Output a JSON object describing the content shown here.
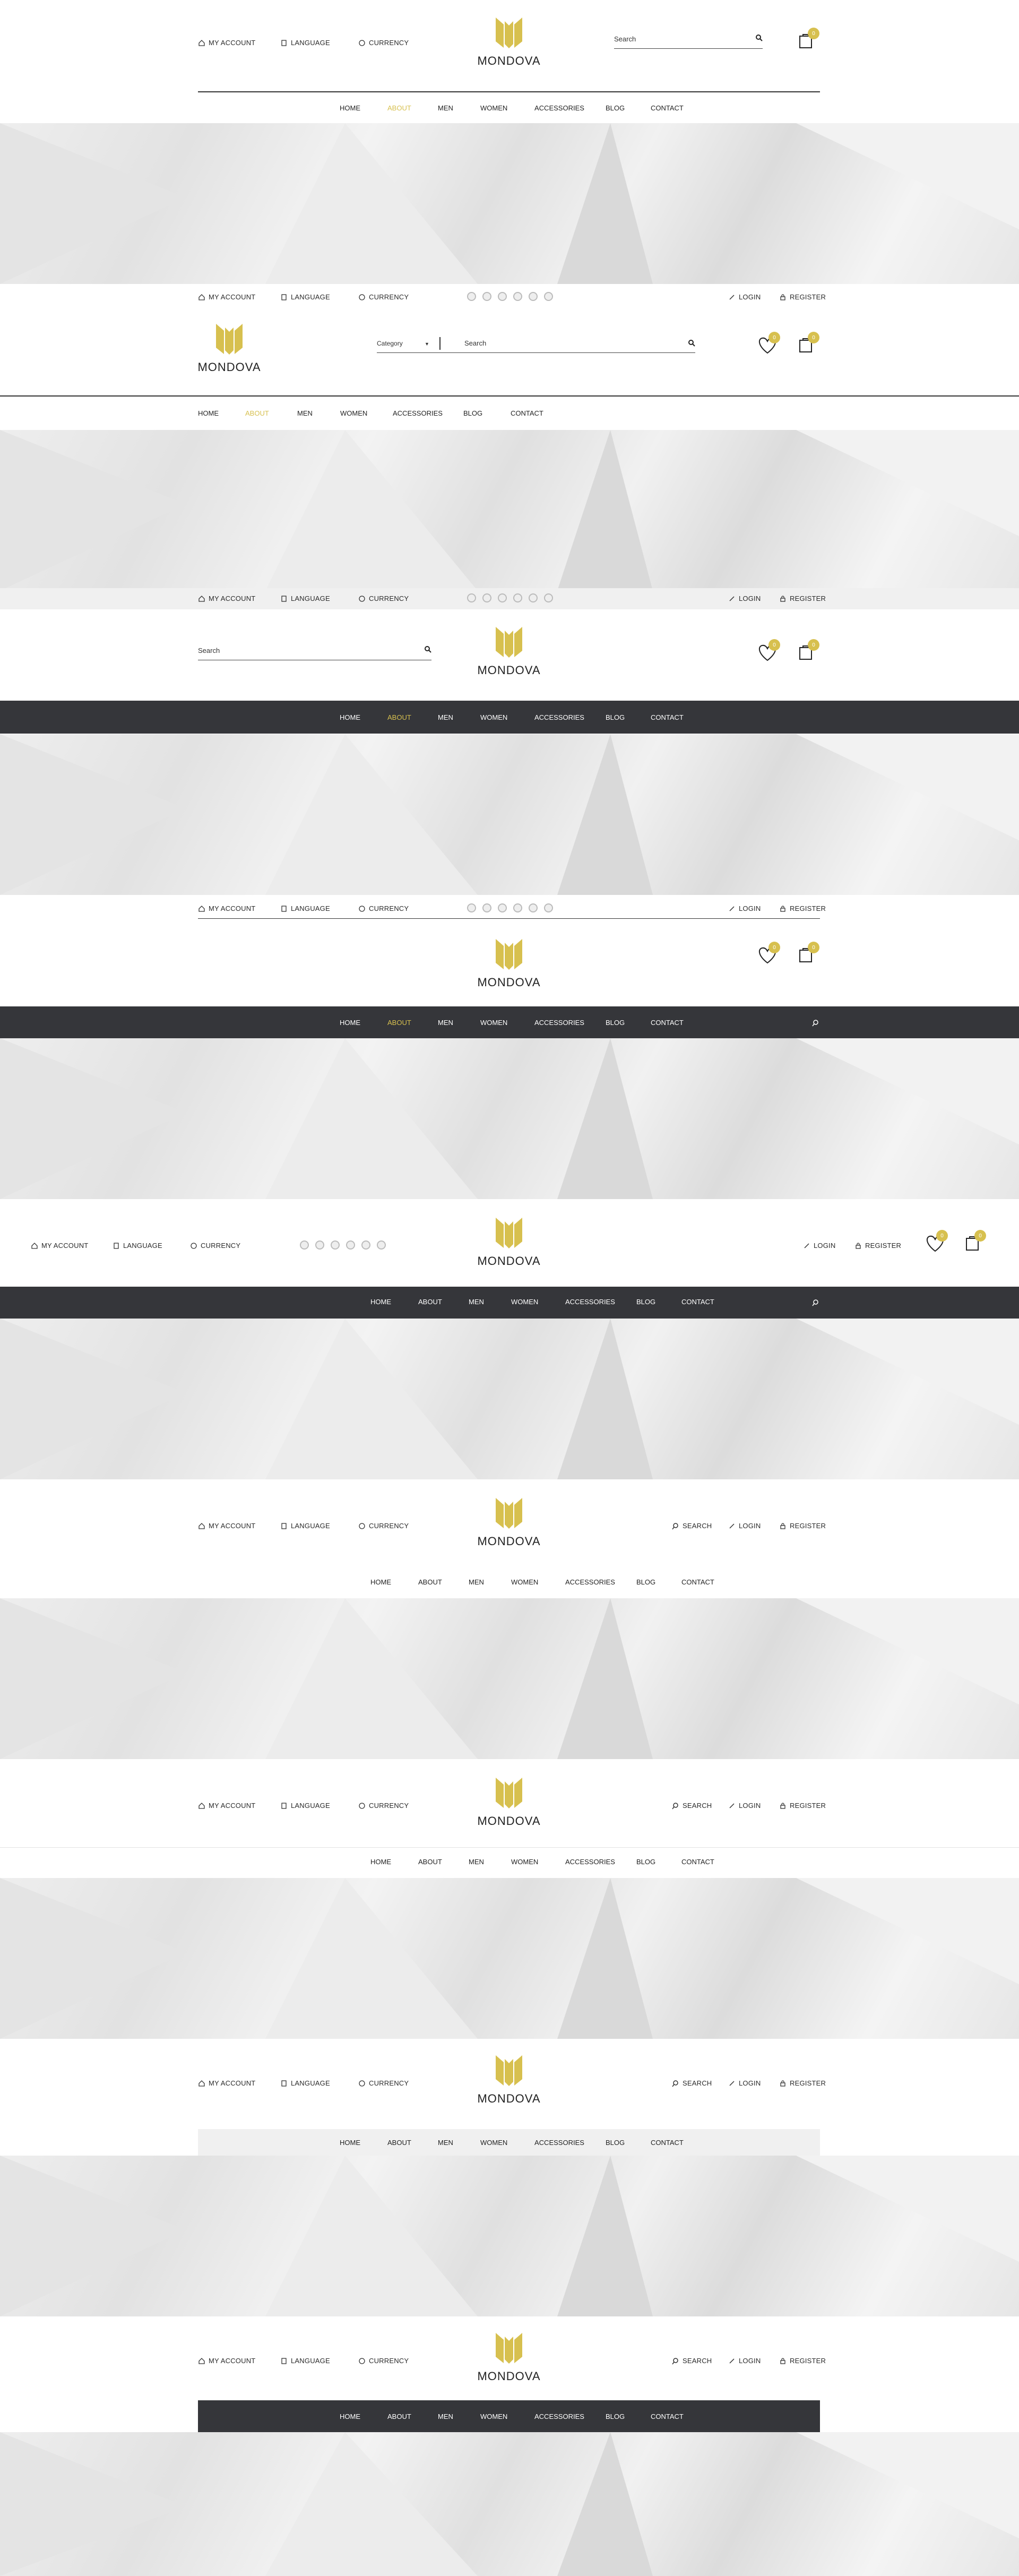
{
  "brand": {
    "name": "MONDOVA",
    "accent": "#d7c04f",
    "dark": "#35363a"
  },
  "top_links": {
    "account": "MY ACCOUNT",
    "language": "LANGUAGE",
    "currency": "CURRENCY",
    "login": "LOGIN",
    "register": "REGISTER",
    "search": "SEARCH"
  },
  "nav": [
    "HOME",
    "ABOUT",
    "MEN",
    "WOMEN",
    "ACCESSORIES",
    "BLOG",
    "CONTACT"
  ],
  "search": {
    "placeholder": "Search",
    "category": "Category"
  },
  "badge": {
    "cart": "0",
    "wish": "0"
  },
  "icons": [
    "home-icon",
    "book-icon",
    "currency-icon",
    "login-icon",
    "register-icon",
    "search-icon",
    "cart-icon",
    "heart-icon",
    "chevron-down-icon",
    "social-icon"
  ]
}
